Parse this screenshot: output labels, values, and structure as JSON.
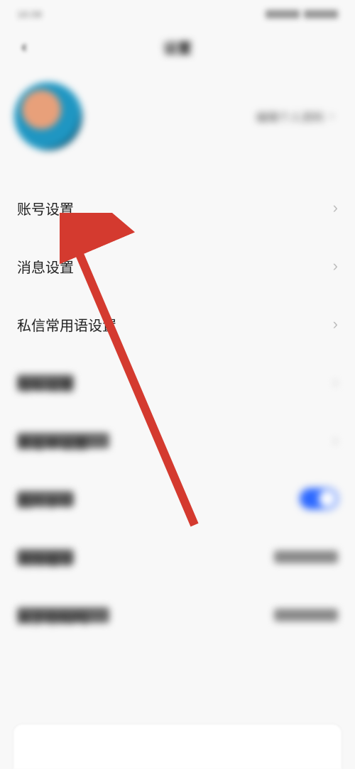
{
  "status": {
    "time": "16:08"
  },
  "nav": {
    "title": "设置",
    "back": "‹"
  },
  "profile": {
    "edit_label": "编辑个人资料",
    "chevron": "›"
  },
  "menu": {
    "items": [
      {
        "label": "账号设置",
        "blurred": false,
        "right": "chevron"
      },
      {
        "label": "消息设置",
        "blurred": false,
        "right": "chevron"
      },
      {
        "label": "私信常用语设置",
        "blurred": false,
        "right": "chevron"
      },
      {
        "label": "隐私设置",
        "blurred": true,
        "right": "chevron"
      },
      {
        "label": "黑名单设置",
        "blurred": true,
        "right": "chevron"
      },
      {
        "label": "图片水印",
        "blurred": true,
        "right": "toggle"
      },
      {
        "label": "清除缓存",
        "blurred": true,
        "right": "value"
      },
      {
        "label": "关于你知吗",
        "blurred": true,
        "right": "value"
      }
    ]
  },
  "arrow": {
    "color": "#d43a2f"
  }
}
